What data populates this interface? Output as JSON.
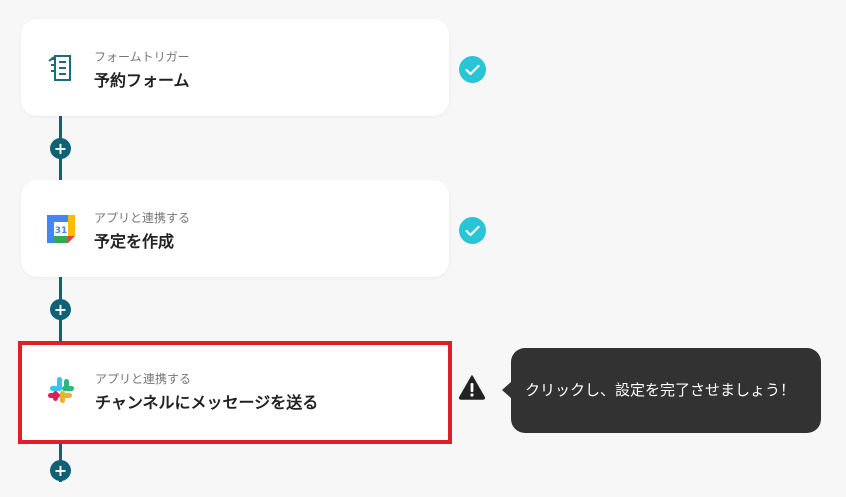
{
  "steps": [
    {
      "type_label": "フォームトリガー",
      "title": "予約フォーム",
      "icon": "form-icon",
      "status": "complete"
    },
    {
      "type_label": "アプリと連携する",
      "title": "予定を作成",
      "icon": "google-calendar-icon",
      "status": "complete"
    },
    {
      "type_label": "アプリと連携する",
      "title": "チャンネルにメッセージを送る",
      "icon": "slack-icon",
      "status": "warning"
    }
  ],
  "tooltip": {
    "message": "クリックし、設定を完了させましょう！"
  },
  "colors": {
    "connector": "#0f6176",
    "check": "#29c4d6",
    "highlight": "#e21e26",
    "tooltip_bg": "#323232"
  }
}
